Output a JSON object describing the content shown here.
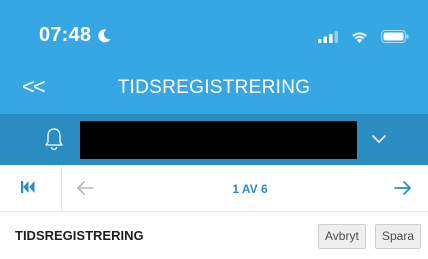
{
  "status_bar": {
    "time": "07:48",
    "icons": [
      "moon-icon",
      "signal-icon",
      "wifi-icon",
      "battery-icon"
    ]
  },
  "nav": {
    "back_label": "<<",
    "title": "TIDSREGISTRERING"
  },
  "user_bar": {
    "icons": [
      "bell-icon",
      "chevron-down-icon"
    ]
  },
  "pager": {
    "page_label": "1 AV 6",
    "icons": [
      "first-page-icon",
      "arrow-left-icon",
      "arrow-right-icon"
    ]
  },
  "form": {
    "title": "TIDSREGISTRERING",
    "cancel_label": "Avbryt",
    "save_label": "Spara"
  },
  "colors": {
    "header_blue": "#37a7e3",
    "bar_blue": "#2b8cc2",
    "pager_accent": "#2b8cc2"
  }
}
